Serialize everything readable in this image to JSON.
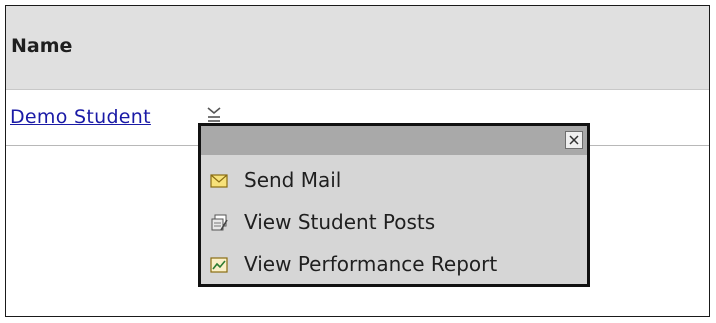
{
  "table": {
    "header": "Name",
    "rows": [
      {
        "name": "Demo Student"
      }
    ]
  },
  "menu": {
    "items": [
      {
        "label": "Send Mail",
        "icon": "envelope-icon"
      },
      {
        "label": "View Student Posts",
        "icon": "posts-icon"
      },
      {
        "label": "View Performance Report",
        "icon": "chart-report-icon"
      }
    ],
    "close_icon": "close-icon"
  },
  "colors": {
    "header_bg": "#e0e0e0",
    "link": "#1a1aa6",
    "popup_bg": "#d6d6d6",
    "popup_titlebar": "#a9a9a9"
  }
}
